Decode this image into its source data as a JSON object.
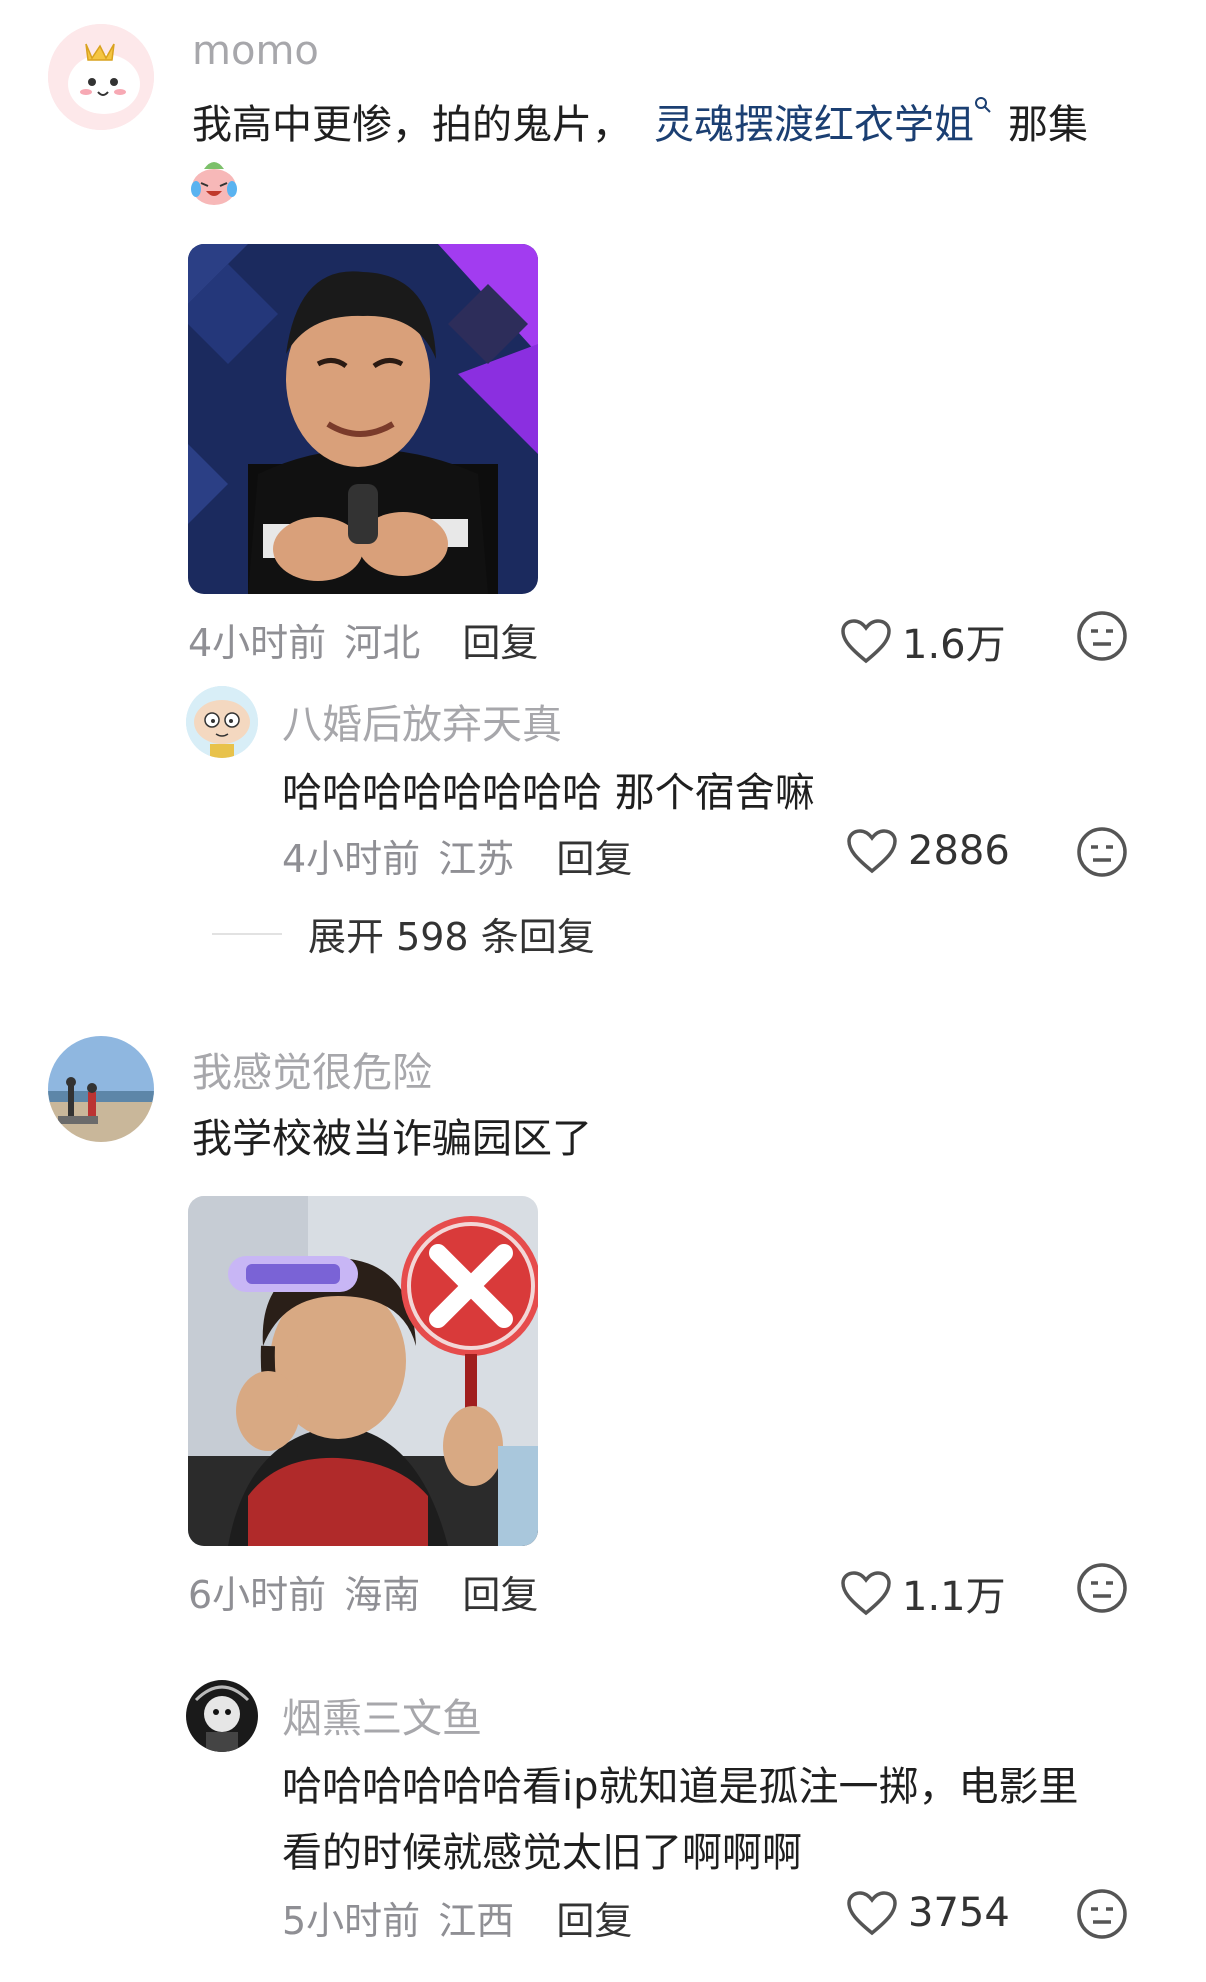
{
  "comments": [
    {
      "username": "momo",
      "text_line1_prefix": "我高中更惨，拍的鬼片，",
      "link_text": "灵魂摆渡红衣学姐",
      "link_search_icon": "search-icon",
      "text_line1_suffix": "那集",
      "emoji": "crying-laugh-emoji",
      "time": "4小时前",
      "location": "河北",
      "reply_label": "回复",
      "likes": "1.6万",
      "reply": {
        "username": "八婚后放弃天真",
        "text": "哈哈哈哈哈哈哈哈 那个宿舍嘛",
        "time": "4小时前",
        "location": "江苏",
        "reply_label": "回复",
        "likes": "2886"
      },
      "expand_label": "展开 598 条回复"
    },
    {
      "username": "我感觉很危险",
      "text": "我学校被当诈骗园区了",
      "time": "6小时前",
      "location": "海南",
      "reply_label": "回复",
      "likes": "1.1万",
      "reply": {
        "username": "烟熏三文鱼",
        "text_line1": "哈哈哈哈哈哈看ip就知道是孤注一掷，电影里",
        "text_line2": "看的时候就感觉太旧了啊啊啊",
        "time": "5小时前",
        "location": "江西",
        "reply_label": "回复",
        "likes": "3754"
      }
    }
  ],
  "colors": {
    "link": "#1b3f72",
    "username": "#a7a7ab",
    "meta": "#8f8f94"
  }
}
